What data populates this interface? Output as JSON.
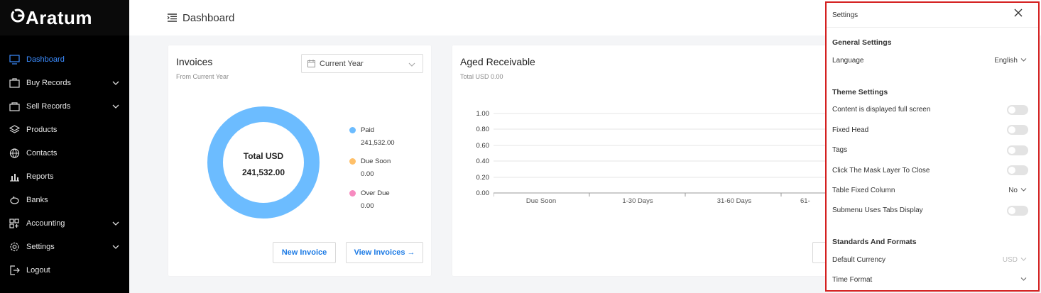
{
  "app": {
    "logo": "Aratum"
  },
  "sidebar": {
    "items": [
      {
        "label": "Dashboard",
        "icon": "monitor-icon",
        "active": true,
        "expandable": false
      },
      {
        "label": "Buy Records",
        "icon": "briefcase-icon",
        "expandable": true
      },
      {
        "label": "Sell Records",
        "icon": "shopping-bag-icon",
        "expandable": true
      },
      {
        "label": "Products",
        "icon": "layers-icon",
        "expandable": false
      },
      {
        "label": "Contacts",
        "icon": "globe-icon",
        "expandable": false
      },
      {
        "label": "Reports",
        "icon": "bar-chart-icon",
        "expandable": false
      },
      {
        "label": "Banks",
        "icon": "piggy-bank-icon",
        "expandable": false
      },
      {
        "label": "Accounting",
        "icon": "grid-plus-icon",
        "expandable": true
      },
      {
        "label": "Settings",
        "icon": "gear-icon",
        "expandable": true
      },
      {
        "label": "Logout",
        "icon": "logout-icon",
        "expandable": false
      }
    ]
  },
  "header": {
    "title": "Dashboard"
  },
  "invoices": {
    "title": "Invoices",
    "subtitle": "From Current Year",
    "period_select": "Current Year",
    "total_label": "Total USD",
    "total_value": "241,532.00",
    "legend": [
      {
        "label": "Paid",
        "value": "241,532.00",
        "color": "#6cbcff"
      },
      {
        "label": "Due Soon",
        "value": "0.00",
        "color": "#ffc069"
      },
      {
        "label": "Over Due",
        "value": "0.00",
        "color": "#f78bc0"
      }
    ],
    "new_button": "New Invoice",
    "view_button": "View Invoices →"
  },
  "aged": {
    "title": "Aged Receivable",
    "subtitle": "Total USD 0.00",
    "y_ticks": [
      "1.00",
      "0.80",
      "0.60",
      "0.40",
      "0.20",
      "0.00"
    ],
    "x_ticks": [
      "Due Soon",
      "1-30 Days",
      "31-60 Days",
      "61-"
    ]
  },
  "settings_drawer": {
    "title": "Settings",
    "general_title": "General Settings",
    "language_label": "Language",
    "language_value": "English",
    "theme_title": "Theme Settings",
    "theme_rows": [
      {
        "label": "Content is displayed full screen",
        "control": "toggle"
      },
      {
        "label": "Fixed Head",
        "control": "toggle"
      },
      {
        "label": "Tags",
        "control": "toggle"
      },
      {
        "label": "Click The Mask Layer To Close",
        "control": "toggle"
      },
      {
        "label": "Table Fixed Column",
        "control": "select",
        "value": "No"
      },
      {
        "label": "Submenu Uses Tabs Display",
        "control": "toggle"
      }
    ],
    "standards_title": "Standards And Formats",
    "currency_label": "Default Currency",
    "currency_value": "USD",
    "time_label": "Time Format"
  },
  "colors": {
    "accent": "#1d7be5",
    "active_menu": "#3b8cff",
    "drawer_border": "#d42020"
  }
}
